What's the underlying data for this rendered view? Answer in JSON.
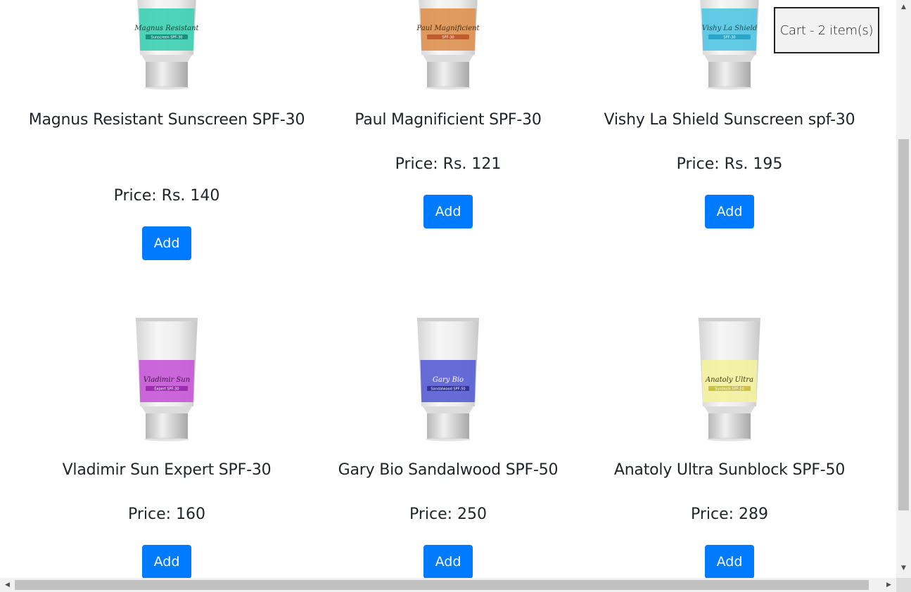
{
  "cart": {
    "label": "Cart - 2 item(s)"
  },
  "products": [
    {
      "name": "Magnus Resistant Sunscreen SPF-30",
      "price": "Price: Rs. 140",
      "button": "Add",
      "tube": {
        "band_color": "#3fd1b3",
        "brand": "Magnus Resistant",
        "sub": "Sunscreen SPF-30",
        "sub_bg": "#1a8f7a",
        "text_color": "#1d3d36"
      }
    },
    {
      "name": "Paul Magnificient SPF-30",
      "price": "Price: Rs. 121",
      "button": "Add",
      "tube": {
        "band_color": "#dd9452",
        "brand": "Paul Magnificient",
        "sub": "SPF-30",
        "sub_bg": "#c25b2e",
        "text_color": "#4a2a14"
      }
    },
    {
      "name": "Vishy La Shield Sunscreen spf-30",
      "price": "Price: Rs. 195",
      "button": "Add",
      "tube": {
        "band_color": "#56c7e3",
        "brand": "Vishy La Shield",
        "sub": "SPF-30",
        "sub_bg": "#2aa7c8",
        "text_color": "#1b4a59"
      }
    },
    {
      "name": "Vladimir Sun Expert SPF-30",
      "price": "Price: 160",
      "button": "Add",
      "tube": {
        "band_color": "#c85ad8",
        "brand": "Vladimir Sun",
        "sub": "Expert SPF-30",
        "sub_bg": "#9c2db0",
        "text_color": "#3c1443"
      }
    },
    {
      "name": "Gary Bio Sandalwood SPF-50",
      "price": "Price: 250",
      "button": "Add",
      "tube": {
        "band_color": "#5a5fd6",
        "brand": "Gary Bio",
        "sub": "Sandalwood SPF-50",
        "sub_bg": "#2f339a",
        "text_color": "#ffffff"
      }
    },
    {
      "name": "Anatoly Ultra Sunblock SPF-50",
      "price": "Price: 289",
      "button": "Add",
      "tube": {
        "band_color": "#f3f1a0",
        "brand": "Anatoly Ultra",
        "sub": "Sunblock SPF-50",
        "sub_bg": "#c9c247",
        "text_color": "#3a3a16"
      }
    }
  ],
  "colors": {
    "button_bg": "#007bff",
    "button_text": "#ffffff",
    "text": "#212529",
    "cart_border": "#222222"
  }
}
